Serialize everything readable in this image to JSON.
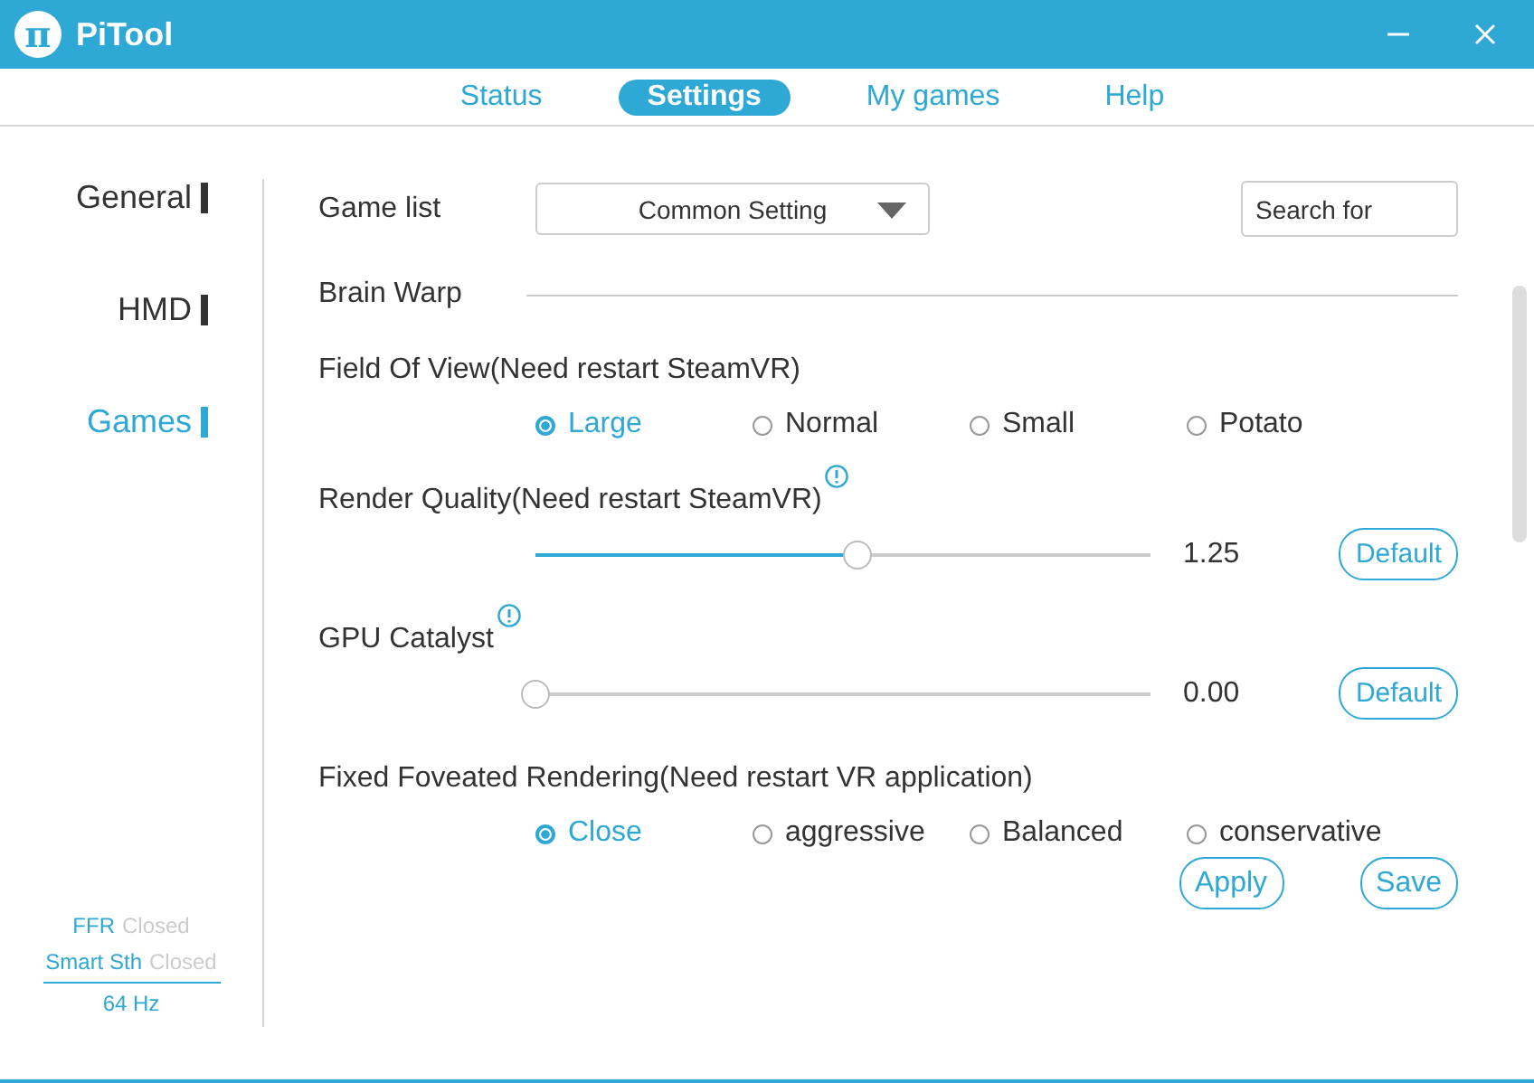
{
  "window": {
    "title": "PiTool",
    "logo": "π"
  },
  "tabs": [
    {
      "label": "Status",
      "selected": false
    },
    {
      "label": "Settings",
      "selected": true
    },
    {
      "label": "My games",
      "selected": false
    },
    {
      "label": "Help",
      "selected": false
    }
  ],
  "sidebar": {
    "items": [
      {
        "label": "General",
        "selected": false
      },
      {
        "label": "HMD",
        "selected": false
      },
      {
        "label": "Games",
        "selected": true
      }
    ],
    "status": [
      {
        "label": "FFR",
        "value": "Closed"
      },
      {
        "label": "Smart Sth",
        "value": "Closed"
      }
    ],
    "refresh": "64 Hz"
  },
  "game_list": {
    "label": "Game list",
    "value": "Common Setting",
    "search_placeholder": "Search for"
  },
  "section": "Brain Warp",
  "settings": [
    {
      "kind": "radio",
      "label": "Field Of View(Need restart SteamVR)",
      "info": false,
      "options": [
        {
          "label": "Large",
          "selected": true
        },
        {
          "label": "Normal",
          "selected": false
        },
        {
          "label": "Small",
          "selected": false
        },
        {
          "label": "Potato",
          "selected": false
        }
      ]
    },
    {
      "kind": "slider",
      "label": "Render Quality(Need restart SteamVR)",
      "info": true,
      "level": 0.5,
      "reading": "1.25",
      "button": "Default"
    },
    {
      "kind": "slider",
      "label": "GPU Catalyst",
      "info": true,
      "level": 0,
      "reading": "0.00",
      "button": "Default"
    },
    {
      "kind": "radio",
      "label": "Fixed Foveated Rendering(Need restart VR application)",
      "info": false,
      "options": [
        {
          "label": "Close",
          "selected": true
        },
        {
          "label": "aggressive",
          "selected": false
        },
        {
          "label": "Balanced",
          "selected": false
        },
        {
          "label": "conservative",
          "selected": false
        }
      ]
    }
  ],
  "actions": [
    "Apply",
    "Save"
  ]
}
